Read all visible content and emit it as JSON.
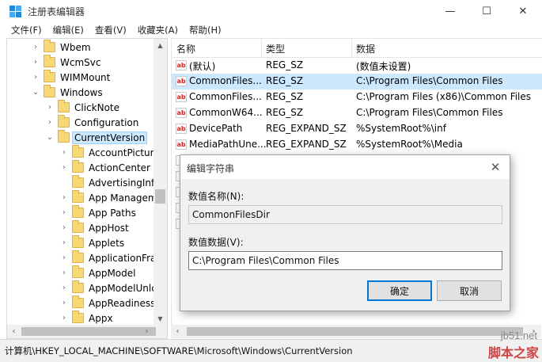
{
  "window": {
    "title": "注册表编辑器",
    "minimize_glyph": "—",
    "maximize_glyph": "☐",
    "close_glyph": "✕"
  },
  "menu": [
    "文件(F)",
    "编辑(E)",
    "查看(V)",
    "收藏夹(A)",
    "帮助(H)"
  ],
  "tree": [
    {
      "label": "Wbem",
      "expander": "›"
    },
    {
      "label": "WcmSvc",
      "expander": "›"
    },
    {
      "label": "WIMMount",
      "expander": "›"
    },
    {
      "label": "Windows",
      "expander": "⌄"
    },
    {
      "label": "ClickNote",
      "expander": "›"
    },
    {
      "label": "Configuration",
      "expander": "›"
    },
    {
      "label": "CurrentVersion",
      "expander": "⌄"
    },
    {
      "label": "AccountPicture",
      "expander": "›"
    },
    {
      "label": "ActionCenter",
      "expander": "›"
    },
    {
      "label": "AdvertisingInfo",
      "expander": ""
    },
    {
      "label": "App Managem",
      "expander": "›"
    },
    {
      "label": "App Paths",
      "expander": "›"
    },
    {
      "label": "AppHost",
      "expander": "›"
    },
    {
      "label": "Applets",
      "expander": "›"
    },
    {
      "label": "ApplicationFrar",
      "expander": "›"
    },
    {
      "label": "AppModel",
      "expander": "›"
    },
    {
      "label": "AppModelUnlc",
      "expander": "›"
    },
    {
      "label": "AppReadiness",
      "expander": "›"
    },
    {
      "label": "Appx",
      "expander": "›"
    }
  ],
  "list": {
    "headers": {
      "name": "名称",
      "type": "类型",
      "data": "数据"
    },
    "rows": [
      {
        "name": "(默认)",
        "type": "REG_SZ",
        "data": "(数值未设置)"
      },
      {
        "name": "CommonFiles...",
        "type": "REG_SZ",
        "data": "C:\\Program Files\\Common Files"
      },
      {
        "name": "CommonFiles...",
        "type": "REG_SZ",
        "data": "C:\\Program Files (x86)\\Common Files"
      },
      {
        "name": "CommonW64...",
        "type": "REG_SZ",
        "data": "C:\\Program Files\\Common Files"
      },
      {
        "name": "DevicePath",
        "type": "REG_EXPAND_SZ",
        "data": "%SystemRoot%\\inf"
      },
      {
        "name": "MediaPathUne...",
        "type": "REG_EXPAND_SZ",
        "data": "%SystemRoot%\\Media"
      }
    ],
    "icon_text": "ab"
  },
  "dialog": {
    "title": "编辑字符串",
    "close_glyph": "✕",
    "name_label": "数值名称(N):",
    "name_value": "CommonFilesDir",
    "data_label": "数值数据(V):",
    "data_value": "C:\\Program Files\\Common Files",
    "ok_label": "确定",
    "cancel_label": "取消"
  },
  "status": {
    "path": "计算机\\HKEY_LOCAL_MACHINE\\SOFTWARE\\Microsoft\\Windows\\CurrentVersion"
  },
  "watermark": {
    "line1": "jb51.net",
    "line2": "脚本之家"
  },
  "colors": {
    "selection": "#cce8ff",
    "accent": "#0078d7",
    "folder": "#f8d775"
  }
}
